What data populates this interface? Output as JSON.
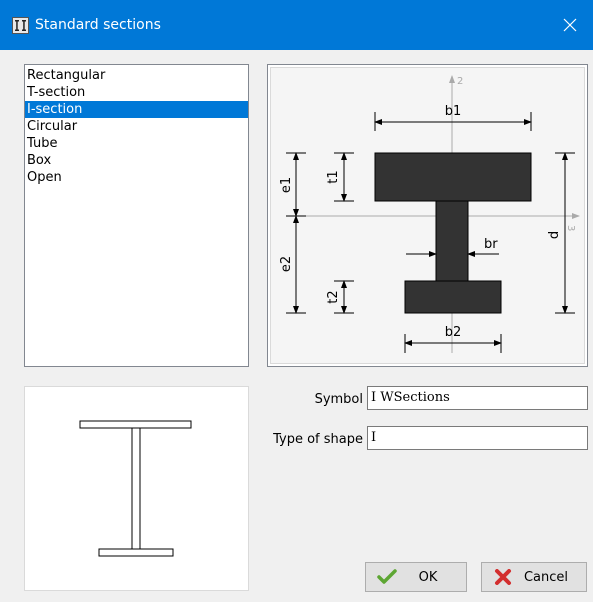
{
  "window": {
    "title": "Standard sections"
  },
  "section_list": {
    "items": [
      {
        "label": "Rectangular",
        "selected": false
      },
      {
        "label": "T-section",
        "selected": false
      },
      {
        "label": "I-section",
        "selected": true
      },
      {
        "label": "Circular",
        "selected": false
      },
      {
        "label": "Tube",
        "selected": false
      },
      {
        "label": "Box",
        "selected": false
      },
      {
        "label": "Open",
        "selected": false
      }
    ]
  },
  "diagram": {
    "labels": {
      "b1": "b1",
      "b2": "b2",
      "t1": "t1",
      "t2": "t2",
      "e1": "e1",
      "e2": "e2",
      "d": "d",
      "br": "br",
      "axis2": "2",
      "axis3": "3"
    }
  },
  "form": {
    "symbol_label": "Symbol",
    "symbol_value": "I WSections",
    "shape_label": "Type of shape",
    "shape_value": "I"
  },
  "buttons": {
    "ok_label": "OK",
    "cancel_label": "Cancel"
  },
  "colors": {
    "titlebar": "#0078d7",
    "selection": "#0078d7",
    "section_fill": "#333333",
    "ok_icon": "#5da633",
    "cancel_icon": "#d32f2f"
  }
}
